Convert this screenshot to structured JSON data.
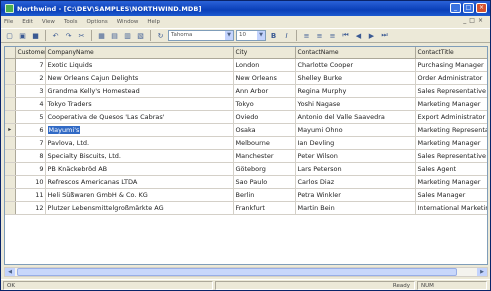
{
  "window": {
    "title": "Northwind - [C:\\DEV\\SAMPLES\\NORTHWIND.MDB]"
  },
  "menu": [
    "File",
    "Edit",
    "View",
    "Tools",
    "Options",
    "Window",
    "Help"
  ],
  "toolbar": {
    "font_name": "Tahoma",
    "font_size": "10"
  },
  "grid": {
    "columns": [
      "",
      "CustomerID",
      "CompanyName",
      "City",
      "ContactName",
      "ContactTitle"
    ],
    "rows": [
      {
        "id": "7",
        "company": "Exotic Liquids",
        "city": "London",
        "contact": "Charlotte Cooper",
        "title": "Purchasing Manager"
      },
      {
        "id": "2",
        "company": "New Orleans Cajun Delights",
        "city": "New Orleans",
        "contact": "Shelley Burke",
        "title": "Order Administrator"
      },
      {
        "id": "3",
        "company": "Grandma Kelly's Homestead",
        "city": "Ann Arbor",
        "contact": "Regina Murphy",
        "title": "Sales Representative"
      },
      {
        "id": "4",
        "company": "Tokyo Traders",
        "city": "Tokyo",
        "contact": "Yoshi Nagase",
        "title": "Marketing Manager"
      },
      {
        "id": "5",
        "company": "Cooperativa de Quesos 'Las Cabras'",
        "city": "Oviedo",
        "contact": "Antonio del Valle Saavedra",
        "title": "Export Administrator"
      },
      {
        "id": "6",
        "company": "Mayumi's",
        "city": "Osaka",
        "contact": "Mayumi Ohno",
        "title": "Marketing Representative"
      },
      {
        "id": "7",
        "company": "Pavlova, Ltd.",
        "city": "Melbourne",
        "contact": "Ian Devling",
        "title": "Marketing Manager"
      },
      {
        "id": "8",
        "company": "Specialty Biscuits, Ltd.",
        "city": "Manchester",
        "contact": "Peter Wilson",
        "title": "Sales Representative"
      },
      {
        "id": "9",
        "company": "PB Knäckebröd AB",
        "city": "Göteborg",
        "contact": "Lars Peterson",
        "title": "Sales Agent"
      },
      {
        "id": "10",
        "company": "Refrescos Americanas LTDA",
        "city": "Sao Paulo",
        "contact": "Carlos Diaz",
        "title": "Marketing Manager"
      },
      {
        "id": "11",
        "company": "Heli Süßwaren GmbH & Co. KG",
        "city": "Berlin",
        "contact": "Petra Winkler",
        "title": "Sales Manager"
      },
      {
        "id": "12",
        "company": "Plutzer Lebensmittelgroßmärkte AG",
        "city": "Frankfurt",
        "contact": "Martin Bein",
        "title": "International Marketing Mgr."
      }
    ],
    "selected_index": 5
  },
  "status": {
    "left": "OK",
    "middle": "Ready",
    "right": "NUM"
  }
}
